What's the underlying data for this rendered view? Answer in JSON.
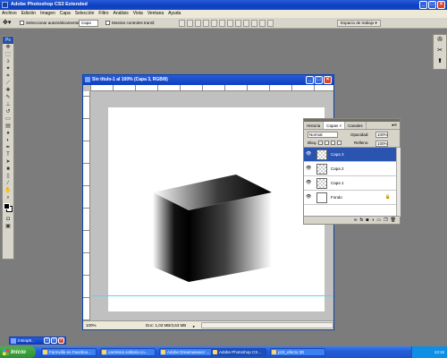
{
  "app": {
    "title": "Adobe Photoshop CS3 Extended",
    "window_controls": [
      "_",
      "□",
      "×"
    ]
  },
  "menu": [
    "Archivo",
    "Edición",
    "Imagen",
    "Capa",
    "Selección",
    "Filtro",
    "Análisis",
    "Vista",
    "Ventana",
    "Ayuda"
  ],
  "options_bar": {
    "tool_icon": "move-icon",
    "auto_select_label": "Seleccionar automáticamente:",
    "auto_select_value": "Capa",
    "transform_label": "Mostrar controles transf.",
    "workspace_label": "Espacio de trabajo ▾"
  },
  "tools": [
    "move-icon",
    "marquee-icon",
    "lasso-icon",
    "magic-wand-icon",
    "crop-icon",
    "slice-icon",
    "healing-icon",
    "brush-icon",
    "stamp-icon",
    "history-brush-icon",
    "eraser-icon",
    "gradient-icon",
    "blur-icon",
    "dodge-icon",
    "pen-icon",
    "type-icon",
    "path-select-icon",
    "shape-icon",
    "notes-icon",
    "eyedropper-icon",
    "hand-icon",
    "zoom-icon"
  ],
  "document": {
    "title": "Sin título-1 al 100% (Capa 3, RGB/8)",
    "zoom": "100%",
    "doc_info": "Doc: 1,03 MB/3,63 MB"
  },
  "layers_panel": {
    "tabs": [
      "Historia",
      "Capas ×",
      "Canales"
    ],
    "active_tab": 1,
    "blend_mode": "Normal",
    "opacity_label": "Opacidad:",
    "opacity_value": "100%",
    "lock_label": "Bloq.:",
    "fill_label": "Relleno:",
    "fill_value": "100%",
    "layers": [
      {
        "name": "Capa 3",
        "selected": true,
        "visible": true,
        "locked": false
      },
      {
        "name": "Capa 2",
        "selected": false,
        "visible": true,
        "locked": false
      },
      {
        "name": "Capa 1",
        "selected": false,
        "visible": true,
        "locked": false
      },
      {
        "name": "Fondo",
        "selected": false,
        "visible": true,
        "locked": true
      }
    ],
    "bottom_icons": [
      "link-icon",
      "fx-icon",
      "mask-icon",
      "adjustment-icon",
      "group-icon",
      "new-layer-icon",
      "trash-icon"
    ]
  },
  "minimized_window": {
    "label": "Inteop8..."
  },
  "taskbar": {
    "start_label": "Inicio",
    "tasks": [
      {
        "label": "Farmville en Faceboo...",
        "active": false
      },
      {
        "label": "carretera solitaria co...",
        "active": false
      },
      {
        "label": "Adobe Dreamweaver ...",
        "active": false
      },
      {
        "label": "Adobe Photoshop CS...",
        "active": true
      },
      {
        "label": "p23_efecto 3D",
        "active": false
      }
    ],
    "clock": "13:15"
  },
  "colors": {
    "workspace_bg": "#7c7c7c",
    "xp_blue": "#0a3fbf",
    "selected_layer": "#2a54b0",
    "guide": "#50d8ff"
  }
}
